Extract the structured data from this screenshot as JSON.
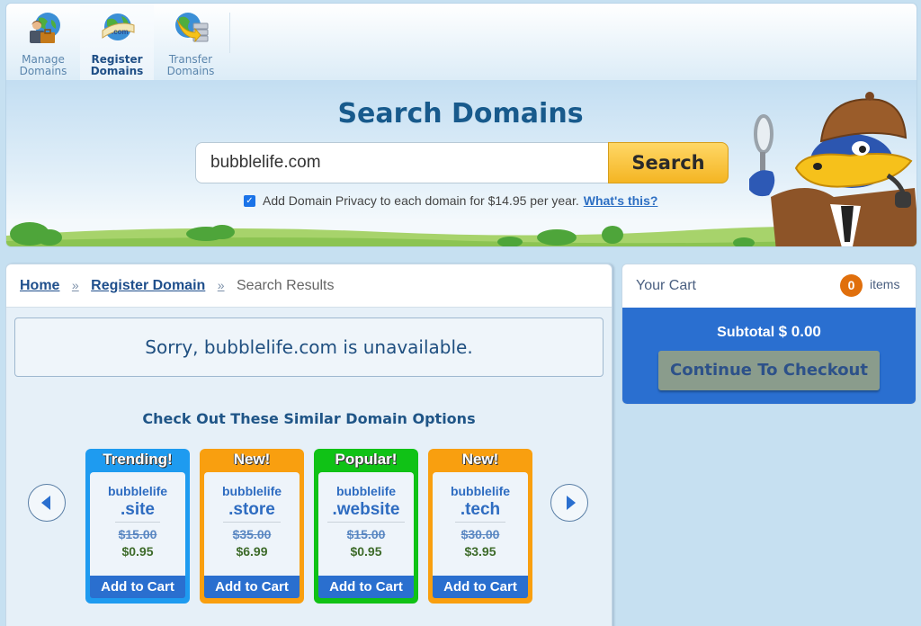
{
  "nav": {
    "items": [
      {
        "label_line1": "Manage",
        "label_line2": "Domains",
        "icon": "manage-domains-icon",
        "active": false
      },
      {
        "label_line1": "Register",
        "label_line2": "Domains",
        "icon": "register-domains-icon",
        "active": true
      },
      {
        "label_line1": "Transfer",
        "label_line2": "Domains",
        "icon": "transfer-domains-icon",
        "active": false
      }
    ]
  },
  "hero": {
    "title": "Search Domains",
    "search_value": "bubblelife.com",
    "search_button": "Search",
    "privacy_checked": true,
    "privacy_text": "Add Domain Privacy to each domain for $14.95 per year.",
    "privacy_link": "What's this?"
  },
  "breadcrumb": {
    "home": "Home",
    "register": "Register Domain",
    "separator": "»",
    "current": "Search Results"
  },
  "results": {
    "unavailable_message": "Sorry, bubblelife.com is unavailable.",
    "similar_heading": "Check Out These Similar Domain Options",
    "cards": [
      {
        "badge": "Trending!",
        "name": "bubblelife",
        "tld": ".site",
        "old_price": "$15.00",
        "new_price": "$0.95",
        "button": "Add to Cart",
        "color": "#1e9bf0"
      },
      {
        "badge": "New!",
        "name": "bubblelife",
        "tld": ".store",
        "old_price": "$35.00",
        "new_price": "$6.99",
        "button": "Add to Cart",
        "color": "#f99f0f"
      },
      {
        "badge": "Popular!",
        "name": "bubblelife",
        "tld": ".website",
        "old_price": "$15.00",
        "new_price": "$0.95",
        "button": "Add to Cart",
        "color": "#10c216"
      },
      {
        "badge": "New!",
        "name": "bubblelife",
        "tld": ".tech",
        "old_price": "$30.00",
        "new_price": "$3.95",
        "button": "Add to Cart",
        "color": "#f99f0f"
      }
    ]
  },
  "cart": {
    "title": "Your Cart",
    "count": "0",
    "items_label": "items",
    "subtotal_label": "Subtotal",
    "subtotal_value": "$ 0.00",
    "checkout_button": "Continue To Checkout"
  }
}
